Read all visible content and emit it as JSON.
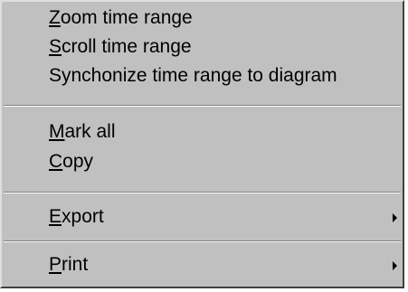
{
  "menu": {
    "items": [
      {
        "accel": "Z",
        "rest": "oom time range"
      },
      {
        "accel": "S",
        "rest": "croll time range"
      },
      {
        "accel": "",
        "rest": "Synchonize time range to diagram"
      },
      {
        "accel": "M",
        "rest": "ark all"
      },
      {
        "accel": "C",
        "rest": "opy"
      },
      {
        "accel": "E",
        "rest": "xport",
        "submenu": true
      },
      {
        "accel": "P",
        "rest": "rint",
        "submenu": true
      }
    ],
    "submenu_arrow_icon": "triangle-right-icon"
  }
}
